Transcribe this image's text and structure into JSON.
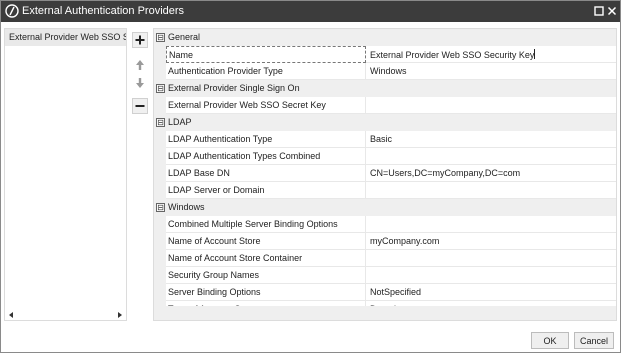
{
  "window": {
    "title": "External Authentication Providers",
    "logo_icon": "circle-slash-logo",
    "maximize_icon": "maximize-icon",
    "close_icon": "close-icon"
  },
  "left_panel": {
    "items": [
      {
        "label": "External Provider Web SSO Secret Key"
      }
    ]
  },
  "toolbar": {
    "add_icon": "plus-icon",
    "up_icon": "arrow-up-icon",
    "down_icon": "arrow-down-icon",
    "remove_icon": "minus-icon"
  },
  "property_grid": {
    "general": {
      "label": "General",
      "toggle": "⊟",
      "props": [
        {
          "name": "Name",
          "value": "External Provider Web SSO Security Key"
        },
        {
          "name": "Authentication Provider Type",
          "value": "Windows"
        }
      ]
    },
    "sso": {
      "label": "External Provider Single Sign On",
      "toggle": "⊟",
      "props": [
        {
          "name": "External Provider Web SSO Secret Key",
          "value": ""
        }
      ]
    },
    "ldap": {
      "label": "LDAP",
      "toggle": "⊟",
      "props": [
        {
          "name": "LDAP Authentication Type",
          "value": "Basic"
        },
        {
          "name": "LDAP Authentication Types Combined",
          "value": ""
        },
        {
          "name": "LDAP Base DN",
          "value": "CN=Users,DC=myCompany,DC=com"
        },
        {
          "name": "LDAP Server or Domain",
          "value": ""
        }
      ]
    },
    "windows": {
      "label": "Windows",
      "toggle": "⊟",
      "props": [
        {
          "name": "Combined Multiple Server Binding Options",
          "value": ""
        },
        {
          "name": "Name of Account Store",
          "value": "myCompany.com"
        },
        {
          "name": "Name of Account Store Container",
          "value": ""
        },
        {
          "name": "Security Group Names",
          "value": ""
        },
        {
          "name": "Server Binding Options",
          "value": "NotSpecified"
        },
        {
          "name": "Type of Account Store",
          "value": "Domain"
        }
      ]
    }
  },
  "footer": {
    "ok_label": "OK",
    "cancel_label": "Cancel"
  }
}
